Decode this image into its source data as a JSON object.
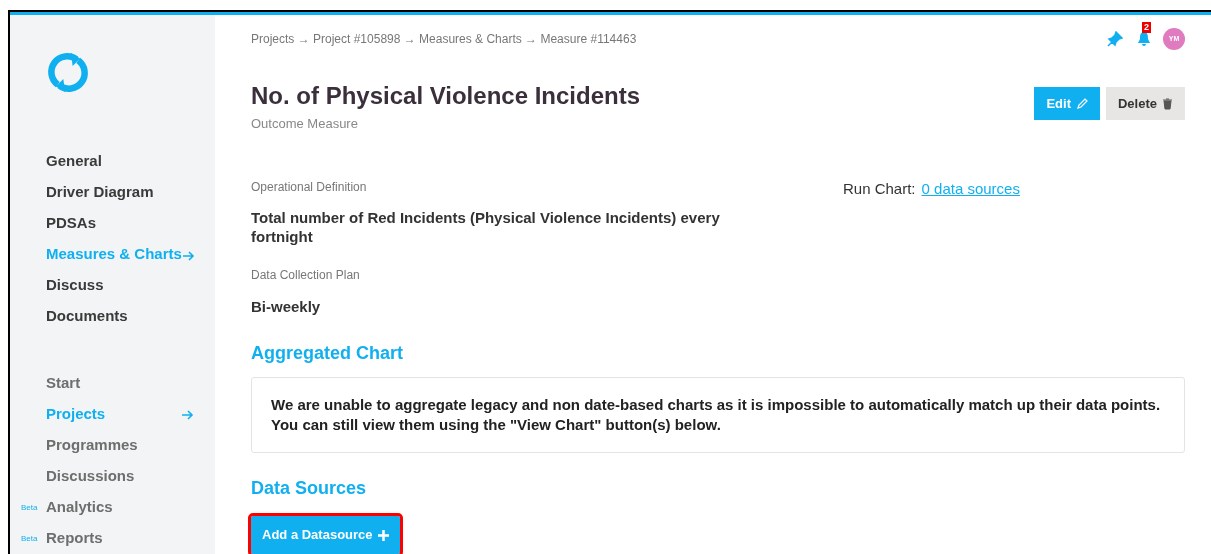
{
  "sidebar": {
    "project_nav": [
      {
        "label": "General",
        "selected": false
      },
      {
        "label": "Driver Diagram",
        "selected": false
      },
      {
        "label": "PDSAs",
        "selected": false
      },
      {
        "label": "Measures & Charts",
        "selected": true
      },
      {
        "label": "Discuss",
        "selected": false
      },
      {
        "label": "Documents",
        "selected": false
      }
    ],
    "main_nav": [
      {
        "label": "Start",
        "selected": false
      },
      {
        "label": "Projects",
        "selected": true
      },
      {
        "label": "Programmes",
        "selected": false
      },
      {
        "label": "Discussions",
        "selected": false
      },
      {
        "label": "Analytics",
        "selected": false,
        "badge": "Beta"
      },
      {
        "label": "Reports",
        "selected": false,
        "badge": "Beta"
      }
    ]
  },
  "breadcrumb": "Projects → Project #105898 → Measures & Charts → Measure #114463",
  "header": {
    "notification_count": "2",
    "avatar": "YM"
  },
  "title": "No. of Physical Violence Incidents",
  "subtitle": "Outcome Measure",
  "actions": [
    "Edit",
    "Delete"
  ],
  "operational_definition": {
    "label": "Operational Definition",
    "value": "Total number of Red Incidents (Physical Violence Incidents) every fortnight"
  },
  "data_collection_plan": {
    "label": "Data Collection Plan",
    "value": "Bi-weekly"
  },
  "run_chart": {
    "label": "Run Chart:",
    "link": "0 data sources"
  },
  "aggregated_chart": {
    "heading": "Aggregated Chart",
    "message": "We are unable to aggregate legacy and non date-based charts as it is impossible to automatically match up their data points. You can still view them using the \"View Chart\" button(s) below."
  },
  "data_sources": {
    "heading": "Data Sources",
    "button": {
      "label": "Add a Datasource",
      "highlighted": true
    }
  }
}
